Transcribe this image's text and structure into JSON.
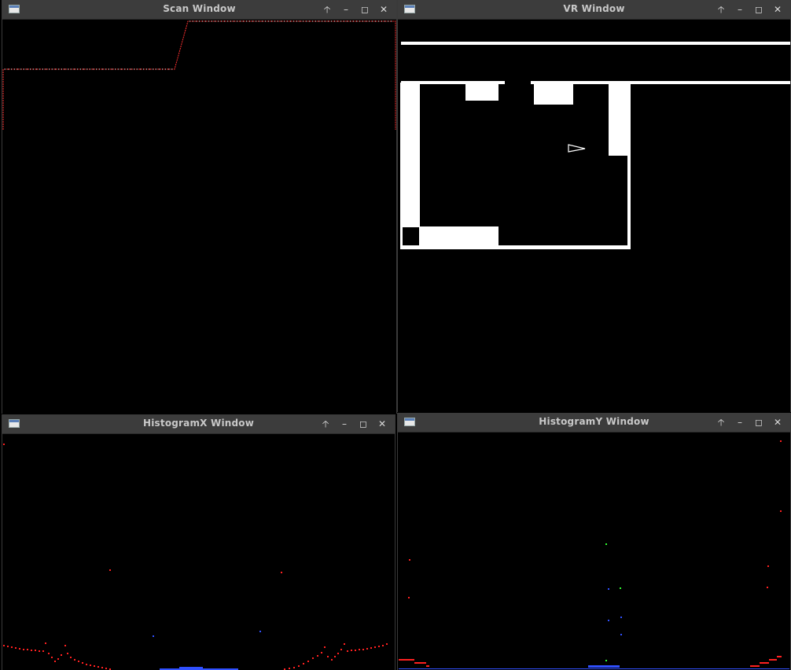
{
  "windows": {
    "scan": {
      "title": "Scan Window"
    },
    "vr": {
      "title": "VR Window"
    },
    "histx": {
      "title": "HistogramX Window"
    },
    "histy": {
      "title": "HistogramY Window"
    }
  },
  "titlebar_buttons": {
    "above": "🡡",
    "minimize": "–",
    "maximize": "◻",
    "close": "✕"
  },
  "colors": {
    "trace": "#ff2020",
    "wall": "#ffffff",
    "blue": "#3050ff",
    "green": "#30ff30",
    "background": "#000000",
    "titlebar": "#3c3c3c"
  }
}
